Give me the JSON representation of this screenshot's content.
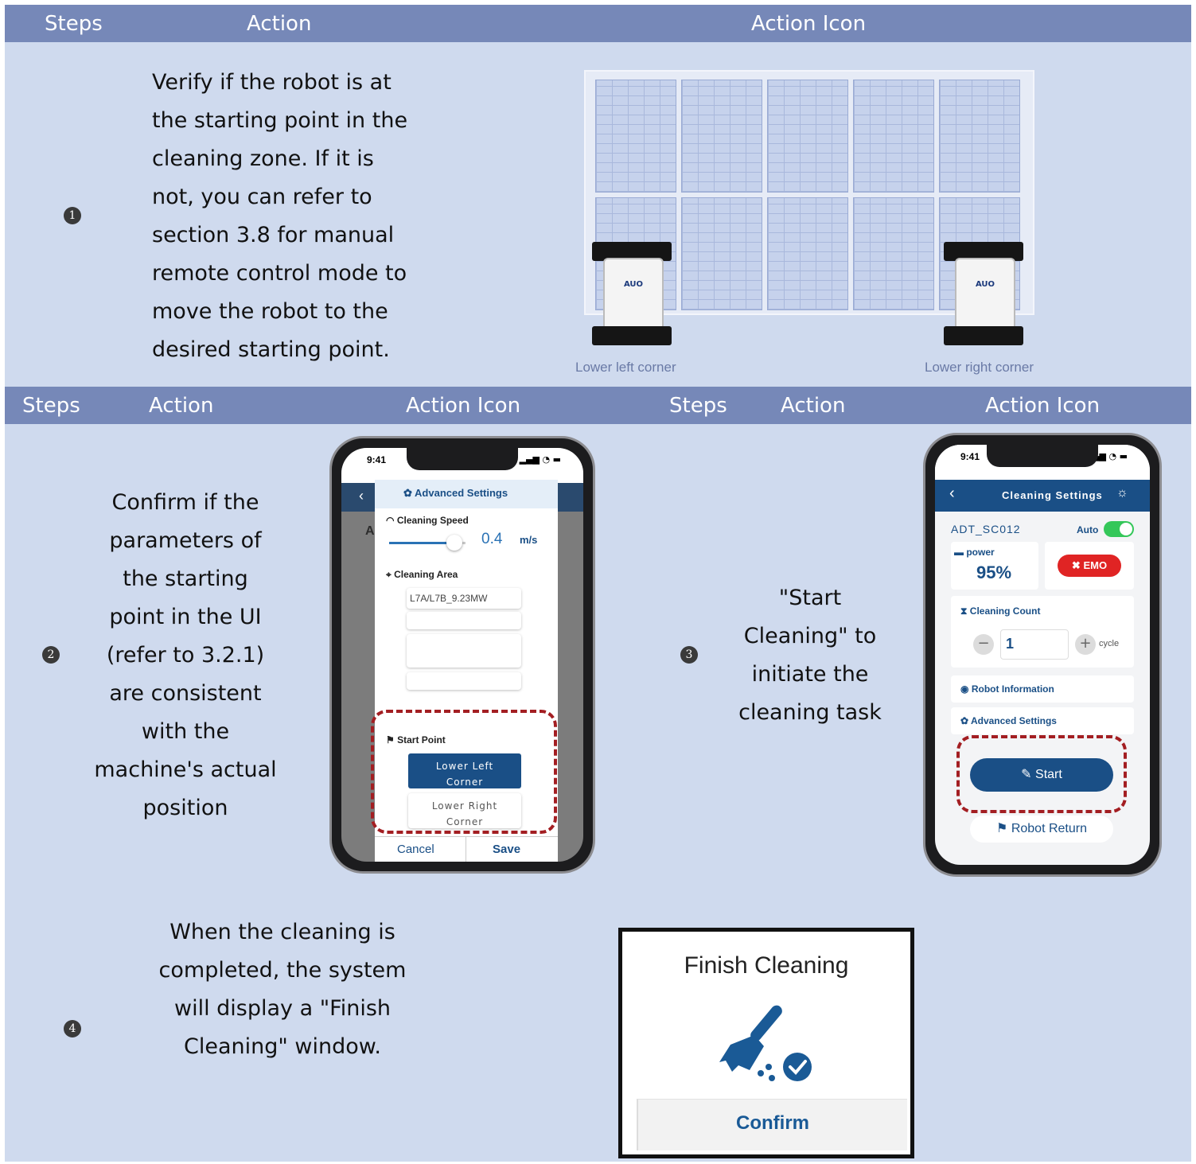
{
  "header1": {
    "steps": "Steps",
    "action": "Action",
    "action_icon": "Action Icon"
  },
  "step1": {
    "number": "1",
    "text": "Verify if the robot is at the starting point in the cleaning zone. If it is not, you can refer to section 3.8 for manual remote control mode to move the robot to the desired starting point.",
    "caption_left": "Lower left corner",
    "caption_right": "Lower right corner",
    "robot_logo": "AUO"
  },
  "header2": {
    "steps": "Steps",
    "action": "Action",
    "action_icon": "Action Icon",
    "steps_b": "Steps",
    "action_b": "Action",
    "action_icon_b": "Action Icon"
  },
  "step2": {
    "number": "2",
    "text": "Confirm if the parameters of the starting point in the UI (refer to 3.2.1) are consistent with the machine's actual position",
    "phone": {
      "time": "9:41",
      "title": "Advanced Settings",
      "speed_label": "Cleaning Speed",
      "speed_value": "0.4",
      "speed_unit": "m/s",
      "speed_fraction": 0.85,
      "area_label": "Cleaning Area",
      "area_value": "L7A/L7B_9.23MW",
      "start_point_label": "Start Point",
      "opt_left": "Lower Left Corner",
      "opt_right": "Lower Right Corner",
      "cancel": "Cancel",
      "save": "Save",
      "bg_letter": "A"
    }
  },
  "step3": {
    "number": "3",
    "text": "\"Start Cleaning\" to initiate the cleaning task",
    "phone": {
      "time": "9:41",
      "title": "Cleaning Settings",
      "device": "ADT_SC012",
      "auto": "Auto",
      "power_label": "power",
      "power_value": "95%",
      "emo": "EMO",
      "count_label": "Cleaning Count",
      "count_value": "1",
      "cycle": "cycle",
      "robot_info": "Robot Information",
      "advanced": "Advanced Settings",
      "start": "Start",
      "robot_return": "Robot Return"
    }
  },
  "step4": {
    "number": "4",
    "text": "When the cleaning is completed, the system will display a \"Finish Cleaning\" window.",
    "dialog_title": "Finish Cleaning",
    "dialog_button": "Confirm"
  },
  "colors": {
    "header": "#7688b8",
    "background": "#cfdaee",
    "app_blue": "#1a4f86",
    "dash_red": "#a31e22",
    "emo_red": "#e02424",
    "toggle_green": "#34c759"
  }
}
